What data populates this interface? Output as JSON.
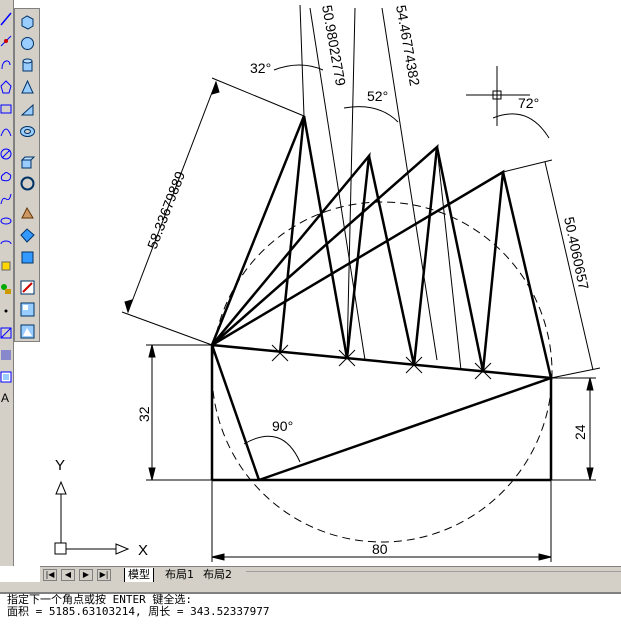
{
  "drawing": {
    "dims": {
      "angle_32": "32°",
      "angle_52": "52°",
      "angle_72": "72°",
      "angle_90": "90°",
      "len_58": "58.33679889",
      "len_50_98": "50.98022779",
      "len_54": "54.46774382",
      "len_50_40": "50.4060657",
      "height_32": "32",
      "height_24": "24",
      "width_80": "80"
    },
    "ucs": {
      "y_label": "Y",
      "x_label": "X"
    }
  },
  "tabs": {
    "model": "模型",
    "layout1": "布局1",
    "layout2": "布局2",
    "nav_first": "|◀",
    "nav_prev": "◀",
    "nav_next": "▶",
    "nav_last": "▶|"
  },
  "command": {
    "line1": "指定下一个角点或按 ENTER 键全选:",
    "line2": "面积 = 5185.63103214, 周长 = 343.52337977"
  }
}
